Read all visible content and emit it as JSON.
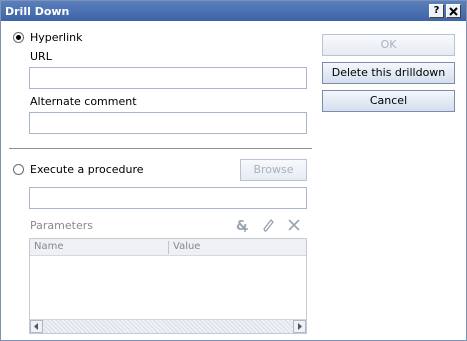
{
  "window": {
    "title": "Drill Down",
    "help_label": "?",
    "close_label": "X"
  },
  "hyperlink": {
    "label": "Hyperlink",
    "selected": true,
    "url_label": "URL",
    "url_value": "",
    "alt_label": "Alternate comment",
    "alt_value": ""
  },
  "procedure": {
    "label": "Execute a procedure",
    "selected": false,
    "browse_label": "Browse",
    "value": "",
    "params_label": "Parameters",
    "icons": [
      "add-parameter-icon",
      "edit-icon",
      "delete-icon"
    ],
    "columns": [
      "Name",
      "Value"
    ],
    "rows": []
  },
  "buttons": {
    "ok": "OK",
    "delete": "Delete this drilldown",
    "cancel": "Cancel"
  }
}
